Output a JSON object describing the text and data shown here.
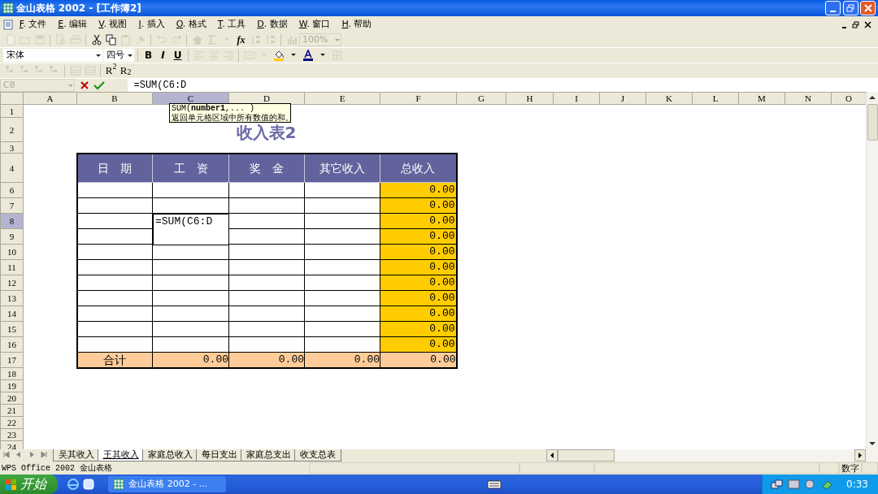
{
  "window": {
    "title": "金山表格 2002 - [工作簿2]"
  },
  "menu": [
    "F. 文件",
    "E. 编辑",
    "V. 视图",
    "I. 插入",
    "O. 格式",
    "T. 工具",
    "D. 数据",
    "W. 窗口",
    "H. 帮助"
  ],
  "toolbars": [
    [
      {
        "kind": "new",
        "disabled": true
      },
      {
        "kind": "open",
        "disabled": true
      },
      {
        "kind": "save",
        "disabled": true
      },
      {
        "kind": "sep"
      },
      {
        "kind": "preview",
        "disabled": true
      },
      {
        "kind": "print",
        "disabled": true
      },
      {
        "kind": "sep"
      },
      {
        "kind": "cut",
        "disabled": false
      },
      {
        "kind": "copy",
        "disabled": false
      },
      {
        "kind": "paste",
        "disabled": true
      },
      {
        "kind": "brush",
        "disabled": true
      },
      {
        "kind": "sep"
      },
      {
        "kind": "undo",
        "disabled": true
      },
      {
        "kind": "redo",
        "disabled": true
      },
      {
        "kind": "sep"
      },
      {
        "kind": "shape",
        "disabled": true
      },
      {
        "kind": "sigma",
        "disabled": true
      },
      {
        "kind": "caret",
        "disabled": true
      },
      {
        "kind": "function",
        "label": "fx",
        "disabled": false
      },
      {
        "kind": "sortup",
        "disabled": true
      },
      {
        "kind": "sortdown",
        "disabled": true
      },
      {
        "kind": "sep"
      },
      {
        "kind": "chart",
        "disabled": true
      },
      {
        "kind": "combo",
        "label": "100%",
        "disabled": true
      }
    ],
    [
      {
        "kind": "font",
        "label": "宋体",
        "disabled": false
      },
      {
        "kind": "size",
        "label": "四号",
        "disabled": false
      },
      {
        "kind": "sep"
      },
      {
        "kind": "bold",
        "label": "B",
        "disabled": false
      },
      {
        "kind": "italic",
        "label": "I",
        "disabled": false
      },
      {
        "kind": "underline",
        "label": "U",
        "disabled": false
      },
      {
        "kind": "sep"
      },
      {
        "kind": "alignleft",
        "disabled": true
      },
      {
        "kind": "aligncenter",
        "disabled": true
      },
      {
        "kind": "alignright",
        "disabled": true
      },
      {
        "kind": "sep"
      },
      {
        "kind": "merge",
        "disabled": true
      },
      {
        "kind": "caret",
        "disabled": true
      },
      {
        "kind": "fill",
        "disabled": false
      },
      {
        "kind": "caret",
        "disabled": false
      },
      {
        "kind": "fontcolor",
        "disabled": false
      },
      {
        "kind": "caret",
        "disabled": false
      },
      {
        "kind": "border",
        "disabled": true
      }
    ],
    [
      {
        "kind": "outline",
        "disabled": true
      },
      {
        "kind": "outline",
        "disabled": true
      },
      {
        "kind": "outline",
        "disabled": true
      },
      {
        "kind": "outline",
        "disabled": true
      },
      {
        "kind": "sep"
      },
      {
        "kind": "grid",
        "disabled": true
      },
      {
        "kind": "grid",
        "disabled": true
      },
      {
        "kind": "sep"
      },
      {
        "kind": "script",
        "label": "R$^{2}$",
        "disabled": false
      },
      {
        "kind": "script",
        "label": "R$_{2}$",
        "disabled": false
      }
    ]
  ],
  "formula_bar": {
    "name_box": "C8",
    "name_box_disabled": true,
    "value": "=SUM(C6:D"
  },
  "tooltip": {
    "signature": "SUM(**number1**,... )",
    "description": "返回单元格区域中所有数值的和。"
  },
  "columns": [
    {
      "label": "A",
      "selected": false
    },
    {
      "label": "B",
      "selected": false
    },
    {
      "label": "C",
      "selected": true
    },
    {
      "label": "D",
      "selected": false
    },
    {
      "label": "E",
      "selected": false
    },
    {
      "label": "F",
      "selected": false
    },
    {
      "label": "G",
      "selected": false
    },
    {
      "label": "H",
      "selected": false
    },
    {
      "label": "I",
      "selected": false
    },
    {
      "label": "J",
      "selected": false
    },
    {
      "label": "K",
      "selected": false
    },
    {
      "label": "L",
      "selected": false
    },
    {
      "label": "M",
      "selected": false
    },
    {
      "label": "N",
      "selected": false
    },
    {
      "label": "O",
      "selected": false
    }
  ],
  "sheet_rows": [
    {
      "label": "1",
      "selected": false,
      "kind": "blank"
    },
    {
      "label": "2",
      "selected": false,
      "kind": "title",
      "text": "收入表2"
    },
    {
      "label": "3",
      "selected": false,
      "kind": "blank"
    },
    {
      "label": "4",
      "selected": false,
      "kind": "header",
      "cells": [
        "日　期",
        "工　资",
        "奖　金",
        "其它收入",
        "总收入"
      ]
    },
    {
      "label": "6",
      "selected": false,
      "kind": "data",
      "total": "0.00"
    },
    {
      "label": "7",
      "selected": false,
      "kind": "data",
      "total": "0.00"
    },
    {
      "label": "8",
      "selected": true,
      "kind": "data",
      "editing": "=SUM(C6:D",
      "total": "0.00"
    },
    {
      "label": "9",
      "selected": false,
      "kind": "data",
      "total": "0.00"
    },
    {
      "label": "10",
      "selected": false,
      "kind": "data",
      "total": "0.00"
    },
    {
      "label": "11",
      "selected": false,
      "kind": "data",
      "total": "0.00"
    },
    {
      "label": "12",
      "selected": false,
      "kind": "data",
      "total": "0.00"
    },
    {
      "label": "13",
      "selected": false,
      "kind": "data",
      "total": "0.00"
    },
    {
      "label": "14",
      "selected": false,
      "kind": "data",
      "total": "0.00"
    },
    {
      "label": "15",
      "selected": false,
      "kind": "data",
      "total": "0.00"
    },
    {
      "label": "16",
      "selected": false,
      "kind": "data",
      "total": "0.00"
    },
    {
      "label": "17",
      "selected": false,
      "kind": "total",
      "text": "合计",
      "values": [
        "0.00",
        "0.00",
        "0.00",
        "0.00"
      ]
    },
    {
      "label": "18",
      "selected": false,
      "kind": "blank"
    },
    {
      "label": "19",
      "selected": false,
      "kind": "blank"
    },
    {
      "label": "20",
      "selected": false,
      "kind": "blank"
    },
    {
      "label": "21",
      "selected": false,
      "kind": "blank"
    },
    {
      "label": "22",
      "selected": false,
      "kind": "blank"
    },
    {
      "label": "23",
      "selected": false,
      "kind": "blank"
    },
    {
      "label": "24",
      "selected": false,
      "kind": "blank"
    }
  ],
  "sheet_tabs": [
    {
      "label": "吴其收入",
      "selected": false
    },
    {
      "label": "王其收入",
      "selected": true
    },
    {
      "label": "家庭总收入",
      "selected": false
    },
    {
      "label": "每日支出",
      "selected": false
    },
    {
      "label": "家庭总支出",
      "selected": false
    },
    {
      "label": "收支总表",
      "selected": false
    }
  ],
  "status_bar": {
    "text": "WPS Office 2002 金山表格",
    "mode": "数字"
  },
  "taskbar": {
    "start": "开始",
    "task": "金山表格 2002 - ...",
    "clock": "0:33"
  }
}
